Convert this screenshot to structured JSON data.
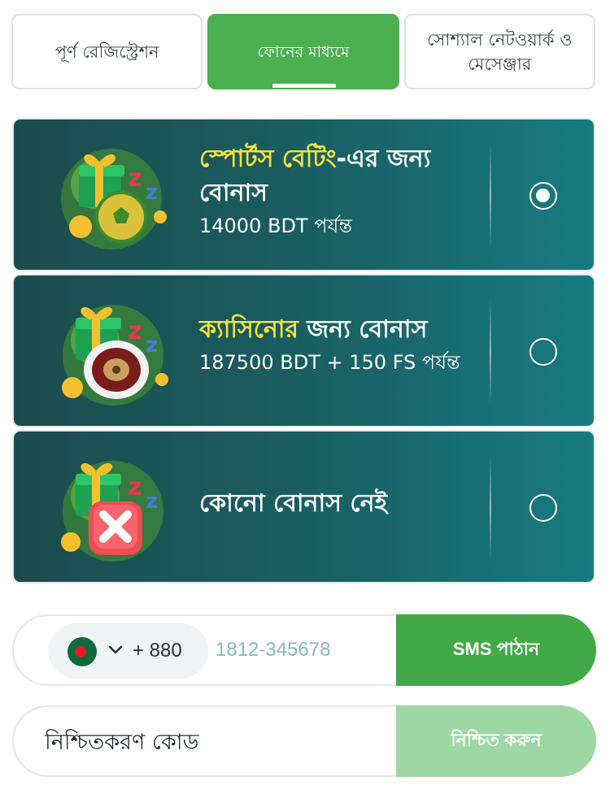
{
  "tabs": [
    {
      "label": "পূর্ণ রেজিস্ট্রেশন"
    },
    {
      "label": "ফোনের মাধ্যমে"
    },
    {
      "label": "সোশ্যাল নেটওয়ার্ক ও মেসেঞ্জার"
    }
  ],
  "bonuses": [
    {
      "title_highlight": "স্পোর্টস বেটিং",
      "title_rest": "-এর জন্য বোনাস",
      "subtitle": "14000 BDT পর্যন্ত",
      "selected": true,
      "art_icon": "sports-bonus-icon"
    },
    {
      "title_highlight": "ক্যাসিনোর",
      "title_rest": " জন্য বোনাস",
      "subtitle": "187500 BDT + 150 FS পর্যন্ত",
      "selected": false,
      "art_icon": "casino-bonus-icon"
    },
    {
      "title_highlight": "",
      "title_rest": "কোনো বোনাস নেই",
      "subtitle": "",
      "selected": false,
      "art_icon": "no-bonus-icon"
    }
  ],
  "phone": {
    "country_code": "+ 880",
    "country_flag_icon": "bangladesh-flag-icon",
    "placeholder": "1812-345678",
    "send_sms_label": "SMS পাঠান"
  },
  "confirmation": {
    "placeholder": "নিশ্চিতকরণ কোড",
    "confirm_label": "নিশ্চিত করুন"
  },
  "colors": {
    "accent_green": "#4caf50",
    "highlight_yellow": "#f6e33c",
    "card_teal": "#1a5c5f",
    "confirm_disabled": "#9dd7a3"
  }
}
